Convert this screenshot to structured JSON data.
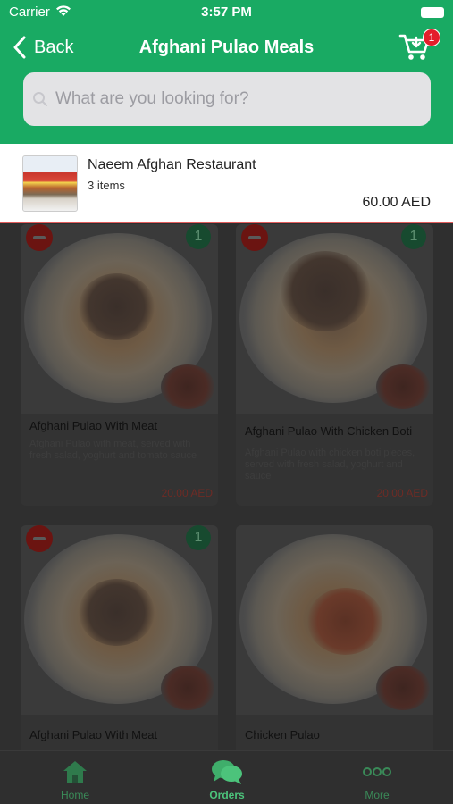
{
  "status": {
    "carrier": "Carrier",
    "time": "3:57 PM"
  },
  "nav": {
    "back_label": "Back",
    "title": "Afghani Pulao Meals",
    "cart_count": "1"
  },
  "search": {
    "placeholder": "What are you looking for?"
  },
  "restaurant": {
    "name": "Naeem Afghan Restaurant",
    "items": "3 items",
    "total": "60.00 AED"
  },
  "products": [
    {
      "name": "Afghani Pulao With Meat",
      "desc": "Afghani Pulao with meat, served with fresh salad, yoghurt and tomato sauce",
      "price": "20.00 AED",
      "qty": "1"
    },
    {
      "name": "Afghani Pulao With Chicken Boti",
      "desc": "Afghani Pulao with chicken boti pieces, served with fresh salad, yoghurt and sauce",
      "price": "20.00 AED",
      "qty": "1"
    },
    {
      "name": "Afghani Pulao With Meat",
      "desc": "",
      "price": "",
      "qty": "1"
    },
    {
      "name": "Chicken Pulao",
      "desc": "",
      "price": "",
      "qty": ""
    }
  ],
  "tabs": {
    "home": "Home",
    "orders": "Orders",
    "more": "More"
  },
  "colors": {
    "brand": "#19aa63",
    "badge": "#e41e2b",
    "tab_active": "#4cc37b"
  }
}
